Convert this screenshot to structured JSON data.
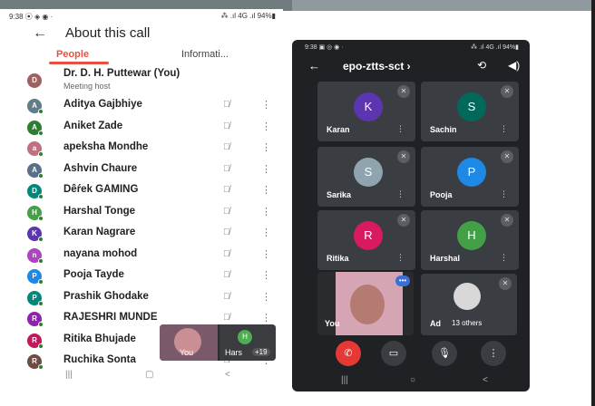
{
  "left": {
    "status_time": "9:38 ⦿ ◈ ◉ ·",
    "status_right": "⁂ .ıl 4G .ıl 94%▮",
    "back": "←",
    "title": "About this call",
    "tabs": [
      "People",
      "Informati..."
    ],
    "host": {
      "initial": "D",
      "name": "Dr. D. H. Puttewar (You)",
      "sub": "Meeting host",
      "color": "#a06060"
    },
    "participants": [
      {
        "initial": "A",
        "name": "Aditya Gajbhiye",
        "color": "#607d8b"
      },
      {
        "initial": "A",
        "name": "Aniket Zade",
        "color": "#2e7d32"
      },
      {
        "initial": "a",
        "name": "apeksha Mondhe",
        "color": "#c07080"
      },
      {
        "initial": "A",
        "name": "Ashvin Chaure",
        "color": "#5a6f8a"
      },
      {
        "initial": "D",
        "name": "Dêŕek GAMING",
        "color": "#00897b"
      },
      {
        "initial": "H",
        "name": "Harshal Tonge",
        "color": "#43a047"
      },
      {
        "initial": "K",
        "name": "Karan Nagrare",
        "color": "#5e35b1"
      },
      {
        "initial": "n",
        "name": "nayana mohod",
        "color": "#ab47bc"
      },
      {
        "initial": "P",
        "name": "Pooja Tayde",
        "color": "#1e88e5"
      },
      {
        "initial": "P",
        "name": "Prashik Ghodake",
        "color": "#00897b"
      },
      {
        "initial": "R",
        "name": "RAJESHRI MUNDE",
        "color": "#8e24aa"
      },
      {
        "initial": "R",
        "name": "Ritika Bhujade",
        "color": "#c2185b"
      },
      {
        "initial": "R",
        "name": "Ruchika Sonta",
        "color": "#6d4c41"
      }
    ],
    "mic_glyph": "🎙̸",
    "more_glyph": "⋮",
    "pip": {
      "you": "You",
      "other": "Hars",
      "other_initial": "H",
      "count": "+19"
    },
    "nav": [
      "|||",
      "▢",
      "<"
    ]
  },
  "right": {
    "status_time": "9:38 ▣ ◎ ◉ ·",
    "status_right": "⁂ .ıl 4G .ıl 94%▮",
    "back": "←",
    "meeting_code": "epo-ztts-sct ›",
    "switch": "⟲",
    "speaker": "◀)",
    "tiles": [
      {
        "initial": "K",
        "name": "Karan",
        "color": "#5e35b1"
      },
      {
        "initial": "S",
        "name": "Sachin",
        "color": "#00695c"
      },
      {
        "initial": "S",
        "name": "Sarika",
        "color": "#8fa4ae"
      },
      {
        "initial": "P",
        "name": "Pooja",
        "color": "#1e88e5"
      },
      {
        "initial": "R",
        "name": "Ritika",
        "color": "#d81b60"
      },
      {
        "initial": "H",
        "name": "Harshal",
        "color": "#43a047"
      }
    ],
    "you_tile": {
      "name": "You",
      "bubble": "•••"
    },
    "others_tile": {
      "name": "Ad",
      "count": "13 others"
    },
    "controls": [
      "✆",
      "▭",
      "🎙",
      "⋮"
    ],
    "nav": [
      "|||",
      "○",
      "<"
    ]
  }
}
